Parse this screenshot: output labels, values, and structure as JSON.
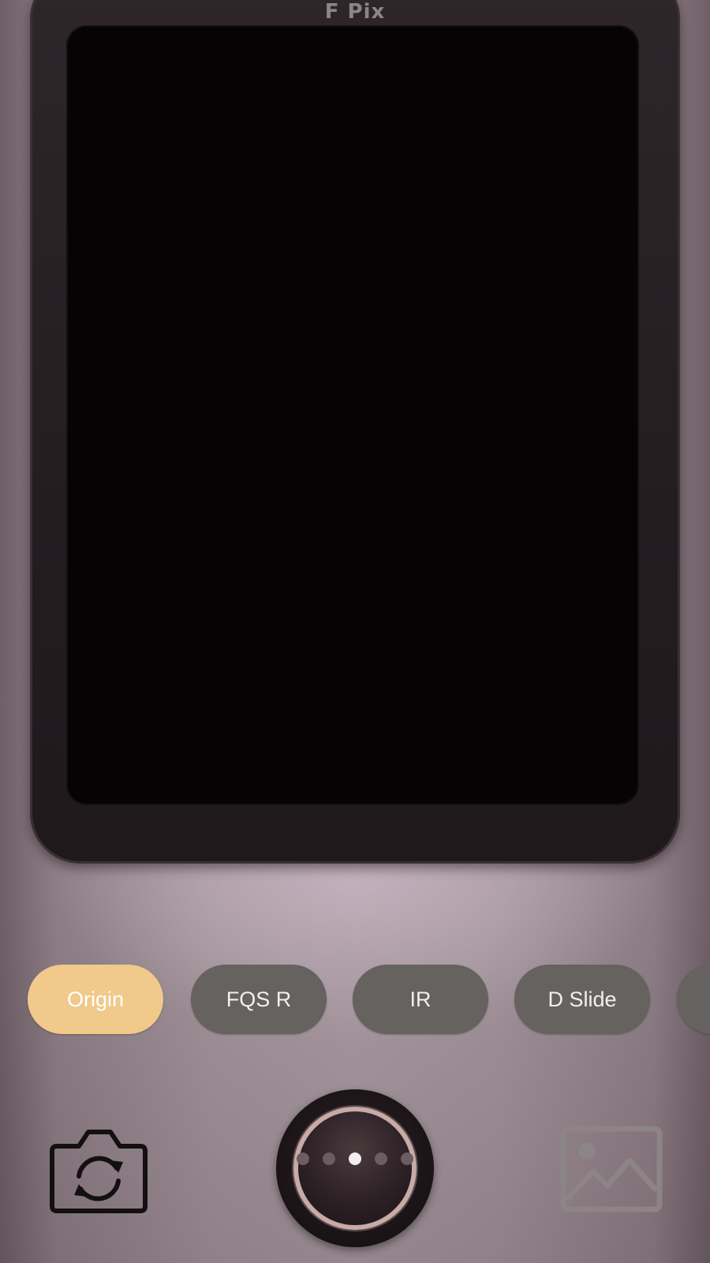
{
  "app": {
    "brand": "F Pix"
  },
  "colors": {
    "active_filter": "#f0c98b",
    "inactive_filter": "#65625f",
    "viewfinder": "#060305"
  },
  "filters": [
    {
      "label": "Origin",
      "active": true
    },
    {
      "label": "FQS R",
      "active": false
    },
    {
      "label": "IR",
      "active": false
    },
    {
      "label": "D Slide",
      "active": false
    },
    {
      "label": "",
      "active": false
    }
  ],
  "pager": {
    "count": 5,
    "active_index": 2
  },
  "icons": {
    "camera_switch": "camera-switch-icon",
    "gallery": "gallery-icon"
  }
}
